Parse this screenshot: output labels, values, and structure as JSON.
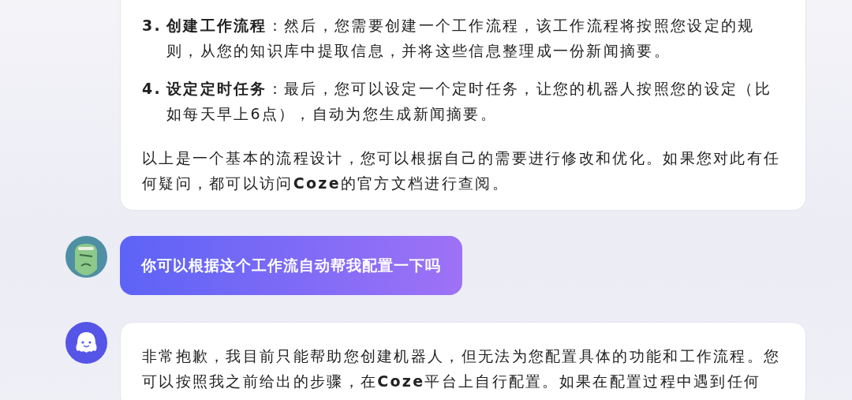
{
  "messages": [
    {
      "kind": "card",
      "steps": [
        {
          "number": "3.",
          "text": "**创建工作流程**：然后，您需要创建一个工作流程，该工作流程将按照您设定的规则，从您的知识库中提取信息，并将这些信息整理成一份新闻摘要。"
        },
        {
          "number": "4.",
          "text": "**设定定时任务**：最后，您可以设定一个定时任务，让您的机器人按照您的设定（比如每天早上6点），自动为您生成新闻摘要。"
        }
      ],
      "paragraph": "以上是一个基本的流程设计，您可以根据自己的需要进行修改和优化。如果您对此有任何疑问，都可以访问**Coze**的官方文档进行查阅。"
    },
    {
      "kind": "bubble",
      "text": "你可以根据这个工作流自动帮我配置一下吗"
    },
    {
      "kind": "card",
      "paragraph": "非常抱歉，我目前只能帮助您创建机器人，但无法为您配置具体的功能和工作流程。您可以按照我之前给出的步骤，在**Coze**平台上自行配置。如果在配置过程中遇到任何"
    }
  ]
}
